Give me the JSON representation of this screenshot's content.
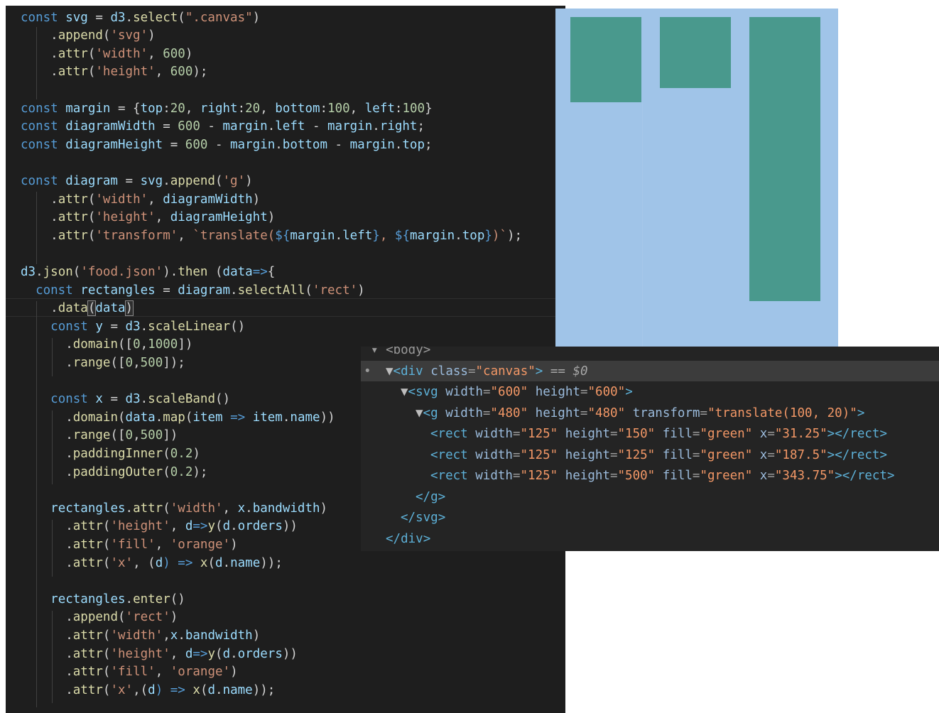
{
  "code_editor": {
    "lines": [
      [
        [
          "const ",
          "kw"
        ],
        [
          "svg",
          "var"
        ],
        [
          " = ",
          "op"
        ],
        [
          "d3",
          "var"
        ],
        [
          ".",
          "pl"
        ],
        [
          "select",
          "fn"
        ],
        [
          "(",
          "pl"
        ],
        [
          "\".canvas\"",
          "str"
        ],
        [
          ")",
          "pl"
        ]
      ],
      [
        [
          "    .",
          "pl"
        ],
        [
          "append",
          "fn"
        ],
        [
          "(",
          "pl"
        ],
        [
          "'svg'",
          "str"
        ],
        [
          ")",
          "pl"
        ]
      ],
      [
        [
          "    .",
          "pl"
        ],
        [
          "attr",
          "fn"
        ],
        [
          "(",
          "pl"
        ],
        [
          "'width'",
          "str"
        ],
        [
          ", ",
          "pl"
        ],
        [
          "600",
          "num"
        ],
        [
          ")",
          "pl"
        ]
      ],
      [
        [
          "    .",
          "pl"
        ],
        [
          "attr",
          "fn"
        ],
        [
          "(",
          "pl"
        ],
        [
          "'height'",
          "str"
        ],
        [
          ", ",
          "pl"
        ],
        [
          "600",
          "num"
        ],
        [
          ");",
          "pl"
        ]
      ],
      [
        [
          "",
          "pl"
        ]
      ],
      [
        [
          "const ",
          "kw"
        ],
        [
          "margin",
          "var"
        ],
        [
          " = {",
          "pl"
        ],
        [
          "top",
          "var"
        ],
        [
          ":",
          "pl"
        ],
        [
          "20",
          "num"
        ],
        [
          ", ",
          "pl"
        ],
        [
          "right",
          "var"
        ],
        [
          ":",
          "pl"
        ],
        [
          "20",
          "num"
        ],
        [
          ", ",
          "pl"
        ],
        [
          "bottom",
          "var"
        ],
        [
          ":",
          "pl"
        ],
        [
          "100",
          "num"
        ],
        [
          ", ",
          "pl"
        ],
        [
          "left",
          "var"
        ],
        [
          ":",
          "pl"
        ],
        [
          "100",
          "num"
        ],
        [
          "}",
          "pl"
        ]
      ],
      [
        [
          "const ",
          "kw"
        ],
        [
          "diagramWidth",
          "var"
        ],
        [
          " = ",
          "op"
        ],
        [
          "600",
          "num"
        ],
        [
          " - ",
          "op"
        ],
        [
          "margin",
          "var"
        ],
        [
          ".",
          "pl"
        ],
        [
          "left",
          "var"
        ],
        [
          " - ",
          "op"
        ],
        [
          "margin",
          "var"
        ],
        [
          ".",
          "pl"
        ],
        [
          "right",
          "var"
        ],
        [
          ";",
          "pl"
        ]
      ],
      [
        [
          "const ",
          "kw"
        ],
        [
          "diagramHeight",
          "var"
        ],
        [
          " = ",
          "op"
        ],
        [
          "600",
          "num"
        ],
        [
          " - ",
          "op"
        ],
        [
          "margin",
          "var"
        ],
        [
          ".",
          "pl"
        ],
        [
          "bottom",
          "var"
        ],
        [
          " - ",
          "op"
        ],
        [
          "margin",
          "var"
        ],
        [
          ".",
          "pl"
        ],
        [
          "top",
          "var"
        ],
        [
          ";",
          "pl"
        ]
      ],
      [
        [
          "",
          "pl"
        ]
      ],
      [
        [
          "const ",
          "kw"
        ],
        [
          "diagram",
          "var"
        ],
        [
          " = ",
          "op"
        ],
        [
          "svg",
          "var"
        ],
        [
          ".",
          "pl"
        ],
        [
          "append",
          "fn"
        ],
        [
          "(",
          "pl"
        ],
        [
          "'g'",
          "str"
        ],
        [
          ")",
          "pl"
        ]
      ],
      [
        [
          "    .",
          "pl"
        ],
        [
          "attr",
          "fn"
        ],
        [
          "(",
          "pl"
        ],
        [
          "'width'",
          "str"
        ],
        [
          ", ",
          "pl"
        ],
        [
          "diagramWidth",
          "var"
        ],
        [
          ")",
          "pl"
        ]
      ],
      [
        [
          "    .",
          "pl"
        ],
        [
          "attr",
          "fn"
        ],
        [
          "(",
          "pl"
        ],
        [
          "'height'",
          "str"
        ],
        [
          ", ",
          "pl"
        ],
        [
          "diagramHeight",
          "var"
        ],
        [
          ")",
          "pl"
        ]
      ],
      [
        [
          "    .",
          "pl"
        ],
        [
          "attr",
          "fn"
        ],
        [
          "(",
          "pl"
        ],
        [
          "'transform'",
          "str"
        ],
        [
          ", ",
          "pl"
        ],
        [
          "`translate(",
          "str"
        ],
        [
          "${",
          "kw"
        ],
        [
          "margin",
          "var"
        ],
        [
          ".",
          "pl"
        ],
        [
          "left",
          "var"
        ],
        [
          "}",
          "kw"
        ],
        [
          ", ",
          "str"
        ],
        [
          "${",
          "kw"
        ],
        [
          "margin",
          "var"
        ],
        [
          ".",
          "pl"
        ],
        [
          "top",
          "var"
        ],
        [
          "}",
          "kw"
        ],
        [
          ")`",
          "str"
        ],
        [
          ");",
          "pl"
        ]
      ],
      [
        [
          "",
          "pl"
        ]
      ],
      [
        [
          "d3",
          "var"
        ],
        [
          ".",
          "pl"
        ],
        [
          "json",
          "fn"
        ],
        [
          "(",
          "pl"
        ],
        [
          "'food.json'",
          "str"
        ],
        [
          ").",
          "pl"
        ],
        [
          "then",
          "fn"
        ],
        [
          " (",
          "pl"
        ],
        [
          "data",
          "var"
        ],
        [
          "=>",
          "kw"
        ],
        [
          "{",
          "pl"
        ]
      ],
      [
        [
          "  ",
          "pl"
        ],
        [
          "const ",
          "kw"
        ],
        [
          "rectangles",
          "var"
        ],
        [
          " = ",
          "op"
        ],
        [
          "diagram",
          "var"
        ],
        [
          ".",
          "pl"
        ],
        [
          "selectAll",
          "fn"
        ],
        [
          "(",
          "pl"
        ],
        [
          "'rect'",
          "str"
        ],
        [
          ")",
          "pl"
        ]
      ],
      [
        [
          "    .",
          "pl"
        ],
        [
          "data",
          "fn"
        ],
        [
          "(",
          "bh"
        ],
        [
          "data",
          "var"
        ],
        [
          ")",
          "bh"
        ]
      ],
      [
        [
          "    ",
          "pl"
        ],
        [
          "const ",
          "kw"
        ],
        [
          "y",
          "var"
        ],
        [
          " = ",
          "op"
        ],
        [
          "d3",
          "var"
        ],
        [
          ".",
          "pl"
        ],
        [
          "scaleLinear",
          "fn"
        ],
        [
          "()",
          "pl"
        ]
      ],
      [
        [
          "      .",
          "pl"
        ],
        [
          "domain",
          "fn"
        ],
        [
          "([",
          "pl"
        ],
        [
          "0",
          "num"
        ],
        [
          ",",
          "pl"
        ],
        [
          "1000",
          "num"
        ],
        [
          "])",
          "pl"
        ]
      ],
      [
        [
          "      .",
          "pl"
        ],
        [
          "range",
          "fn"
        ],
        [
          "([",
          "pl"
        ],
        [
          "0",
          "num"
        ],
        [
          ",",
          "pl"
        ],
        [
          "500",
          "num"
        ],
        [
          "]);",
          "pl"
        ]
      ],
      [
        [
          "",
          "pl"
        ]
      ],
      [
        [
          "    ",
          "pl"
        ],
        [
          "const ",
          "kw"
        ],
        [
          "x",
          "var"
        ],
        [
          " = ",
          "op"
        ],
        [
          "d3",
          "var"
        ],
        [
          ".",
          "pl"
        ],
        [
          "scaleBand",
          "fn"
        ],
        [
          "()",
          "pl"
        ]
      ],
      [
        [
          "      .",
          "pl"
        ],
        [
          "domain",
          "fn"
        ],
        [
          "(",
          "pl"
        ],
        [
          "data",
          "var"
        ],
        [
          ".",
          "pl"
        ],
        [
          "map",
          "fn"
        ],
        [
          "(",
          "pl"
        ],
        [
          "item",
          "var"
        ],
        [
          " => ",
          "kw"
        ],
        [
          "item",
          "var"
        ],
        [
          ".",
          "pl"
        ],
        [
          "name",
          "var"
        ],
        [
          "))",
          "pl"
        ]
      ],
      [
        [
          "      .",
          "pl"
        ],
        [
          "range",
          "fn"
        ],
        [
          "([",
          "pl"
        ],
        [
          "0",
          "num"
        ],
        [
          ",",
          "pl"
        ],
        [
          "500",
          "num"
        ],
        [
          "])",
          "pl"
        ]
      ],
      [
        [
          "      .",
          "pl"
        ],
        [
          "paddingInner",
          "fn"
        ],
        [
          "(",
          "pl"
        ],
        [
          "0.2",
          "num"
        ],
        [
          ")",
          "pl"
        ]
      ],
      [
        [
          "      .",
          "pl"
        ],
        [
          "paddingOuter",
          "fn"
        ],
        [
          "(",
          "pl"
        ],
        [
          "0.2",
          "num"
        ],
        [
          ");",
          "pl"
        ]
      ],
      [
        [
          "",
          "pl"
        ]
      ],
      [
        [
          "    ",
          "pl"
        ],
        [
          "rectangles",
          "var"
        ],
        [
          ".",
          "pl"
        ],
        [
          "attr",
          "fn"
        ],
        [
          "(",
          "pl"
        ],
        [
          "'width'",
          "str"
        ],
        [
          ", ",
          "pl"
        ],
        [
          "x",
          "var"
        ],
        [
          ".",
          "pl"
        ],
        [
          "bandwidth",
          "var"
        ],
        [
          ")",
          "pl"
        ]
      ],
      [
        [
          "      .",
          "pl"
        ],
        [
          "attr",
          "fn"
        ],
        [
          "(",
          "pl"
        ],
        [
          "'height'",
          "str"
        ],
        [
          ", ",
          "pl"
        ],
        [
          "d",
          "var"
        ],
        [
          "=>",
          "kw"
        ],
        [
          "y",
          "fn"
        ],
        [
          "(",
          "pl"
        ],
        [
          "d",
          "var"
        ],
        [
          ".",
          "pl"
        ],
        [
          "orders",
          "var"
        ],
        [
          "))",
          "pl"
        ]
      ],
      [
        [
          "      .",
          "pl"
        ],
        [
          "attr",
          "fn"
        ],
        [
          "(",
          "pl"
        ],
        [
          "'fill'",
          "str"
        ],
        [
          ", ",
          "pl"
        ],
        [
          "'orange'",
          "str"
        ],
        [
          ")",
          "pl"
        ]
      ],
      [
        [
          "      .",
          "pl"
        ],
        [
          "attr",
          "fn"
        ],
        [
          "(",
          "pl"
        ],
        [
          "'x'",
          "str"
        ],
        [
          ", (",
          "pl"
        ],
        [
          "d",
          "var"
        ],
        [
          ") => ",
          "kw"
        ],
        [
          "x",
          "fn"
        ],
        [
          "(",
          "pl"
        ],
        [
          "d",
          "var"
        ],
        [
          ".",
          "pl"
        ],
        [
          "name",
          "var"
        ],
        [
          "));",
          "pl"
        ]
      ],
      [
        [
          "",
          "pl"
        ]
      ],
      [
        [
          "    ",
          "pl"
        ],
        [
          "rectangles",
          "var"
        ],
        [
          ".",
          "pl"
        ],
        [
          "enter",
          "fn"
        ],
        [
          "()",
          "pl"
        ]
      ],
      [
        [
          "      .",
          "pl"
        ],
        [
          "append",
          "fn"
        ],
        [
          "(",
          "pl"
        ],
        [
          "'rect'",
          "str"
        ],
        [
          ")",
          "pl"
        ]
      ],
      [
        [
          "      .",
          "pl"
        ],
        [
          "attr",
          "fn"
        ],
        [
          "(",
          "pl"
        ],
        [
          "'width'",
          "str"
        ],
        [
          ",",
          "pl"
        ],
        [
          "x",
          "var"
        ],
        [
          ".",
          "pl"
        ],
        [
          "bandwidth",
          "var"
        ],
        [
          ")",
          "pl"
        ]
      ],
      [
        [
          "      .",
          "pl"
        ],
        [
          "attr",
          "fn"
        ],
        [
          "(",
          "pl"
        ],
        [
          "'height'",
          "str"
        ],
        [
          ", ",
          "pl"
        ],
        [
          "d",
          "var"
        ],
        [
          "=>",
          "kw"
        ],
        [
          "y",
          "fn"
        ],
        [
          "(",
          "pl"
        ],
        [
          "d",
          "var"
        ],
        [
          ".",
          "pl"
        ],
        [
          "orders",
          "var"
        ],
        [
          "))",
          "pl"
        ]
      ],
      [
        [
          "      .",
          "pl"
        ],
        [
          "attr",
          "fn"
        ],
        [
          "(",
          "pl"
        ],
        [
          "'fill'",
          "str"
        ],
        [
          ", ",
          "pl"
        ],
        [
          "'orange'",
          "str"
        ],
        [
          ")",
          "pl"
        ]
      ],
      [
        [
          "      .",
          "pl"
        ],
        [
          "attr",
          "fn"
        ],
        [
          "(",
          "pl"
        ],
        [
          "'x'",
          "str"
        ],
        [
          ",(",
          "pl"
        ],
        [
          "d",
          "var"
        ],
        [
          ") => ",
          "kw"
        ],
        [
          "x",
          "fn"
        ],
        [
          "(",
          "pl"
        ],
        [
          "d",
          "var"
        ],
        [
          ".",
          "pl"
        ],
        [
          "name",
          "var"
        ],
        [
          "));",
          "pl"
        ]
      ],
      [
        [
          "",
          "pl"
        ]
      ],
      [
        [
          "})",
          "br"
        ]
      ]
    ]
  },
  "rendered_preview": {
    "background_color": "#a0c4e8",
    "bar_color": "#49998d",
    "bars": [
      {
        "height_attr": 150
      },
      {
        "height_attr": 125
      },
      {
        "height_attr": 500
      }
    ]
  },
  "devtools": {
    "partial_top_tag": "<body>",
    "selected_marker": "== $0",
    "lines": [
      {
        "kind": "partial",
        "indent": 0,
        "text": "▾ <body>"
      },
      {
        "kind": "open",
        "indent": 1,
        "expanded": true,
        "selected": true,
        "tag": "div",
        "attrs": [
          [
            "class",
            "canvas"
          ]
        ]
      },
      {
        "kind": "open",
        "indent": 2,
        "expanded": true,
        "tag": "svg",
        "attrs": [
          [
            "width",
            "600"
          ],
          [
            "height",
            "600"
          ]
        ]
      },
      {
        "kind": "open",
        "indent": 3,
        "expanded": true,
        "tag": "g",
        "attrs": [
          [
            "width",
            "480"
          ],
          [
            "height",
            "480"
          ],
          [
            "transform",
            "translate(100, 20)"
          ]
        ]
      },
      {
        "kind": "leaf",
        "indent": 4,
        "tag": "rect",
        "attrs": [
          [
            "width",
            "125"
          ],
          [
            "height",
            "150"
          ],
          [
            "fill",
            "green"
          ],
          [
            "x",
            "31.25"
          ]
        ]
      },
      {
        "kind": "leaf",
        "indent": 4,
        "tag": "rect",
        "attrs": [
          [
            "width",
            "125"
          ],
          [
            "height",
            "125"
          ],
          [
            "fill",
            "green"
          ],
          [
            "x",
            "187.5"
          ]
        ]
      },
      {
        "kind": "leaf",
        "indent": 4,
        "tag": "rect",
        "attrs": [
          [
            "width",
            "125"
          ],
          [
            "height",
            "500"
          ],
          [
            "fill",
            "green"
          ],
          [
            "x",
            "343.75"
          ]
        ]
      },
      {
        "kind": "close",
        "indent": 3,
        "tag": "g"
      },
      {
        "kind": "close",
        "indent": 2,
        "tag": "svg"
      },
      {
        "kind": "close",
        "indent": 1,
        "tag": "div"
      }
    ]
  }
}
